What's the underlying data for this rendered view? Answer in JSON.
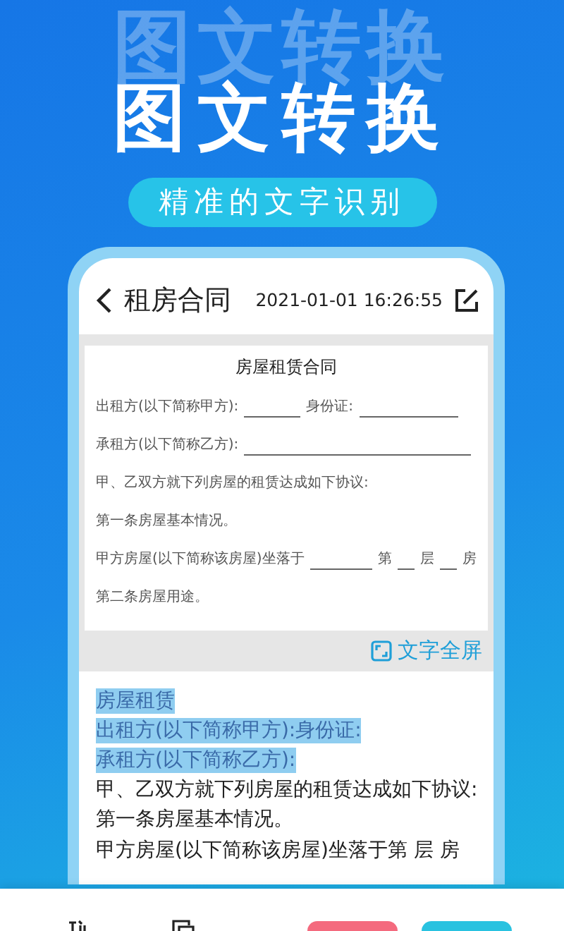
{
  "banner": {
    "background_title": "图文转换",
    "title": "图文转换",
    "subtitle": "精准的文字识别"
  },
  "header": {
    "title": "租房合同",
    "timestamp": "2021-01-01 16:26:55"
  },
  "document": {
    "title": "房屋租赁合同",
    "lines": [
      {
        "parts": [
          {
            "kind": "text",
            "text": "出租方(以下简称甲方):"
          },
          {
            "kind": "blank_short"
          },
          {
            "kind": "text",
            "text": "身份证:"
          },
          {
            "kind": "blank_long"
          }
        ]
      },
      {
        "parts": [
          {
            "kind": "text",
            "text": "承租方(以下简称乙方):"
          },
          {
            "kind": "blank_fill"
          }
        ]
      },
      {
        "parts": [
          {
            "kind": "text",
            "text": "甲、乙双方就下列房屋的租赁达成如下协议:"
          }
        ]
      },
      {
        "parts": [
          {
            "kind": "text",
            "text": "第一条房屋基本情况。"
          }
        ]
      },
      {
        "parts": [
          {
            "kind": "text",
            "text": "甲方房屋(以下简称该房屋)坐落于"
          },
          {
            "kind": "blank_fill"
          },
          {
            "kind": "text",
            "text": "第"
          },
          {
            "kind": "blank_tiny"
          },
          {
            "kind": "text",
            "text": "层"
          },
          {
            "kind": "blank_tiny"
          },
          {
            "kind": "text",
            "text": "房"
          }
        ]
      },
      {
        "parts": [
          {
            "kind": "text",
            "text": "第二条房屋用途。"
          }
        ]
      }
    ]
  },
  "fullscreen_button": "文字全屏",
  "recognized_lines": [
    {
      "text": "房屋租赁",
      "selected": true
    },
    {
      "text": "出租方(以下简称甲方):身份证:",
      "selected": true
    },
    {
      "text": "承租方(以下简称乙方):",
      "selected": true
    },
    {
      "text": "甲、乙双方就下列房屋的租赁达成如下协议:",
      "selected": false
    },
    {
      "text": "第一条房屋基本情况。",
      "selected": false
    },
    {
      "text": "甲方房屋(以下简称该房屋)坐落于第 层 房",
      "selected": false
    }
  ]
}
